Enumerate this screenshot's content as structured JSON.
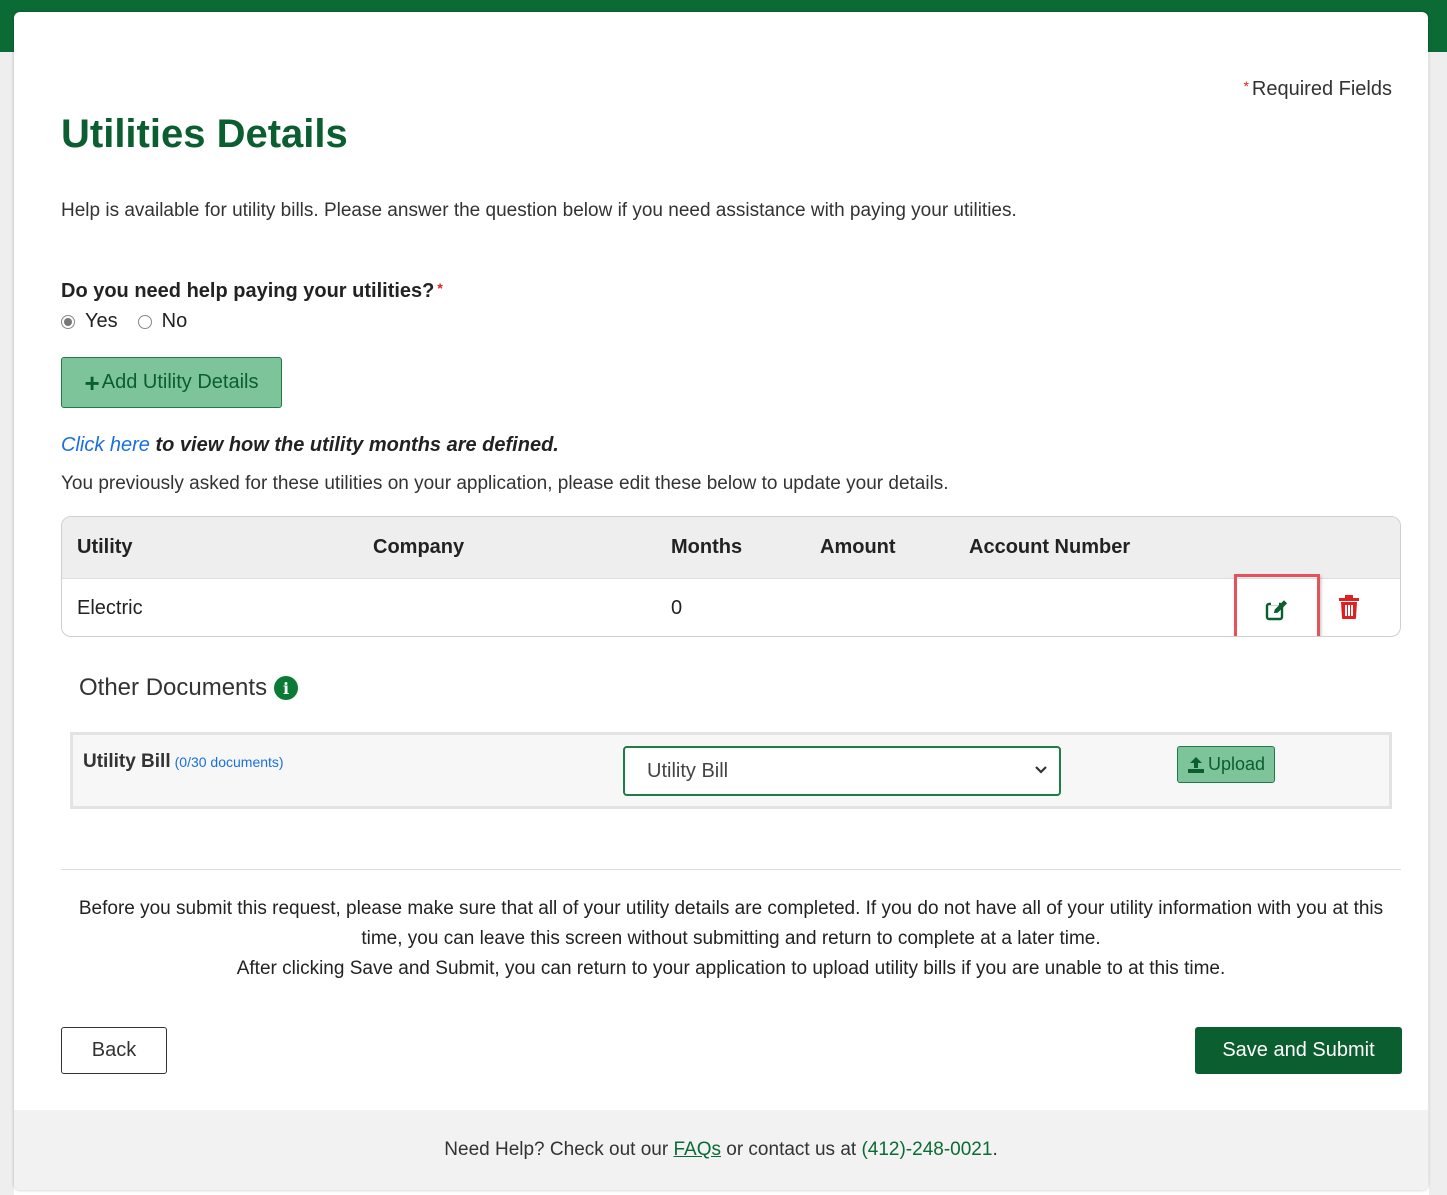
{
  "header": {
    "required_star": "*",
    "required_text": "Required Fields",
    "title": "Utilities Details",
    "intro": "Help is available for utility bills. Please answer the question below if you need assistance with paying your utilities."
  },
  "question": {
    "label": "Do you need help paying your utilities?",
    "star": "*",
    "options": [
      {
        "label": "Yes",
        "selected": true
      },
      {
        "label": "No",
        "selected": false
      }
    ]
  },
  "add_button": {
    "icon": "plus-icon",
    "plus": "+",
    "label": "Add Utility Details"
  },
  "click_line": {
    "link": "Click here",
    "text": " to view how the utility months are defined."
  },
  "previous_text": "You previously asked for these utilities on your application, please edit these below to update your details.",
  "table": {
    "headers": [
      "Utility",
      "Company",
      "Months",
      "Amount",
      "Account Number"
    ],
    "rows": [
      {
        "utility": "Electric",
        "company": "",
        "months": "0",
        "amount": "",
        "account": ""
      }
    ],
    "edit_icon": "edit-icon",
    "delete_icon": "trash-icon"
  },
  "other_documents": {
    "title": "Other Documents",
    "info_icon": "info-icon",
    "info_glyph": "i",
    "doc_label": "Utility Bill",
    "doc_count": "(0/30 documents)",
    "select_value": "Utility Bill",
    "upload_icon": "upload-icon",
    "upload_label": "Upload"
  },
  "notice": {
    "line1": "Before you submit this request, please make sure that all of your utility details are completed. If you do not have all of your utility information with you at this time, you can leave this screen without submitting and return to complete at a later time.",
    "line2": "After clicking Save and Submit, you can return to your application to upload utility bills if you are unable to at this time."
  },
  "buttons": {
    "back": "Back",
    "submit": "Save and Submit"
  },
  "footer": {
    "pre": "Need Help? Check out our ",
    "faq": "FAQs",
    "mid": " or contact us at ",
    "phone": "(412)-248-0021",
    "post": "."
  },
  "colors": {
    "brand_green": "#0b5e2f",
    "light_green": "#7dc49a",
    "link_blue": "#1a6fe0",
    "danger_red": "#e02020",
    "highlight_red": "#e2535d"
  }
}
